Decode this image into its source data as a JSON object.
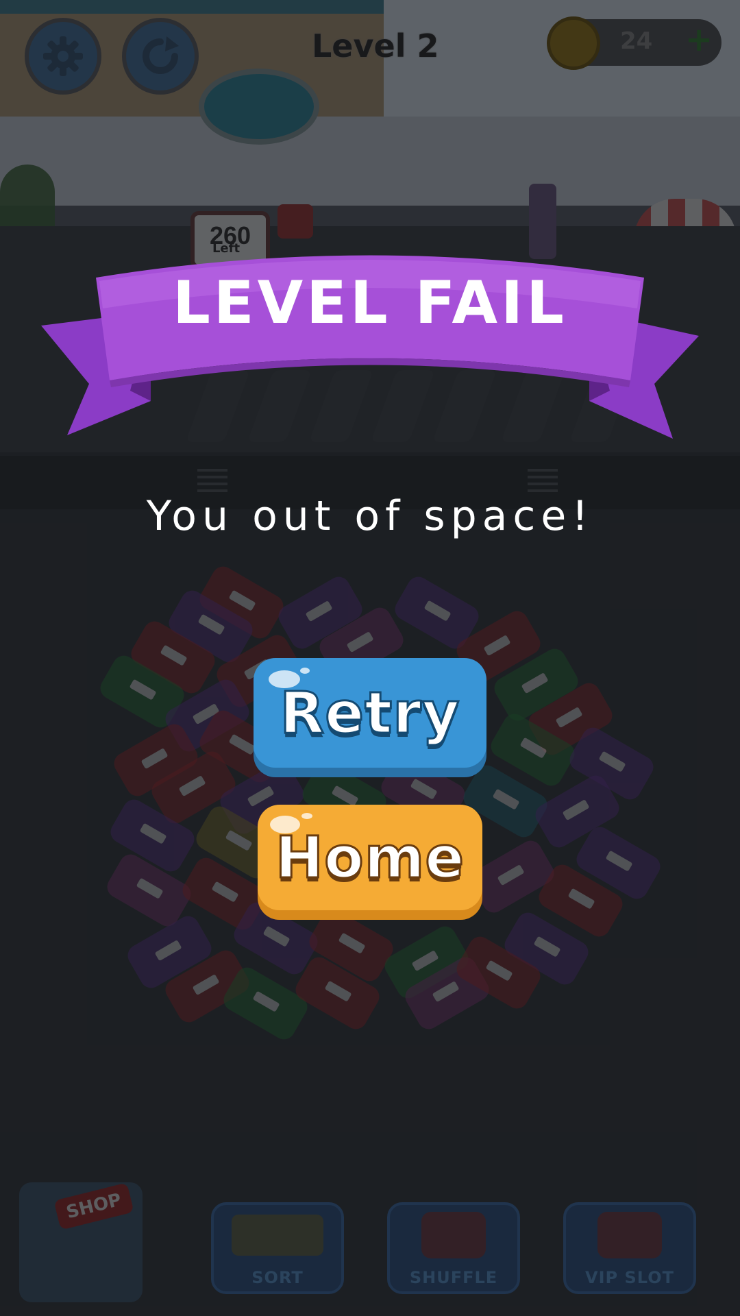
{
  "hud": {
    "level_label": "Level 2",
    "coins": "24",
    "coin_plus": "+",
    "settings_icon": "gear-icon",
    "restart_icon": "restart-icon"
  },
  "scene": {
    "sign_count": "260",
    "sign_sub": "Left"
  },
  "dialog": {
    "banner_title": "LEVEL FAIL",
    "message": "You out of space!",
    "retry_label": "Retry",
    "home_label": "Home"
  },
  "bottom_bar": {
    "shop_label": "SHOP",
    "boosters": [
      {
        "label": "SORT",
        "icon": "sort-icon"
      },
      {
        "label": "SHUFFLE",
        "icon": "shuffle-icon"
      },
      {
        "label": "VIP SLOT",
        "icon": "vip-slot-icon"
      }
    ]
  },
  "colors": {
    "banner": "#a650d8",
    "retry_button": "#3995d6",
    "home_button": "#f5ab35",
    "overlay": "#24272b"
  }
}
